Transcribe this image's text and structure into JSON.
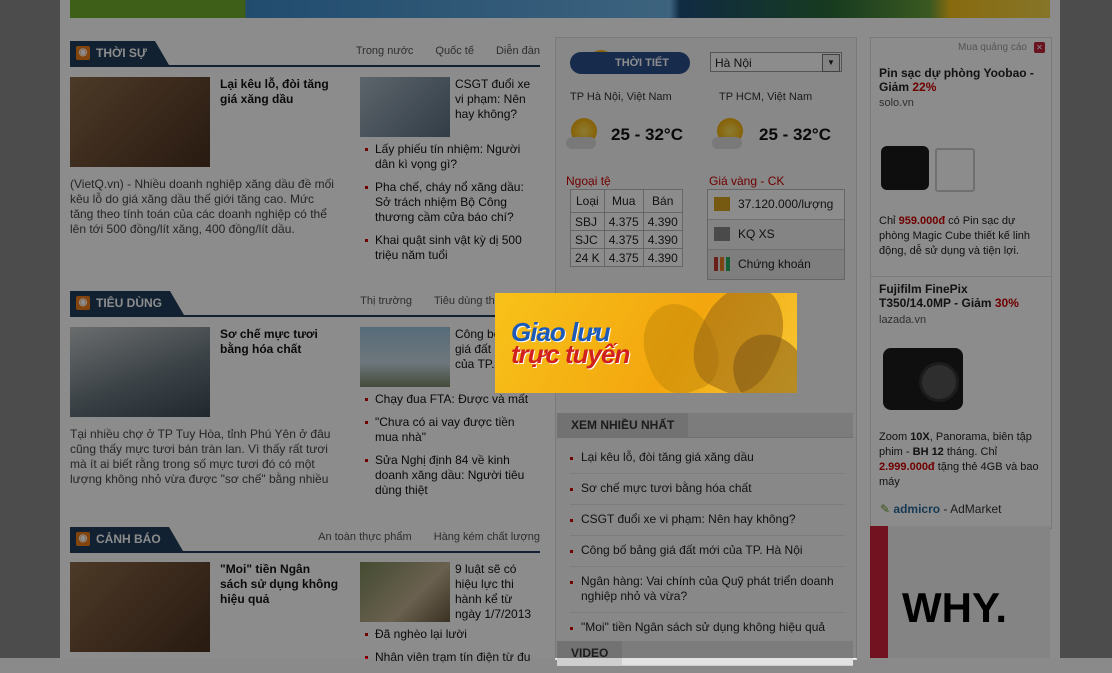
{
  "sections": {
    "thoi_su": {
      "title": "THỜI SỰ",
      "links": [
        "Trong nước",
        "Quốc tế",
        "Diễn đàn"
      ],
      "lead_title": "Lại kêu lỗ, đòi tăng giá xăng dầu",
      "lead_summary": "(VietQ.vn) - Nhiều doanh nghiệp xăng dầu đề mối kêu lỗ do giá xăng dầu thế giới tăng cao. Mức tăng theo tính toán của các doanh nghiệp có thể lên tới 500 đồng/lít xăng, 400 đồng/lít dầu.",
      "side_title": "CSGT đuổi xe vi phạm: Nên hay không?",
      "bullets": [
        "Lấy phiếu tín nhiệm: Người dân kì vọng gì?",
        "Pha chế, cháy nổ xăng dầu: Sở trách nhiệm Bộ Công thương cầm cửa báo chí?",
        "Khai quật sinh vật kỳ dị 500 triệu năm tuổi"
      ]
    },
    "tieu_dung": {
      "title": "TIÊU DÙNG",
      "links": [
        "Thị trường",
        "Tiêu dùng thông minh"
      ],
      "lead_title": "Sơ chế mực tươi bằng hóa chất",
      "lead_summary": "Tại nhiều chợ ở TP Tuy Hòa, tỉnh Phú Yên ở đâu cũng thấy mực tươi bán tràn lan. Vì thấy rất tươi mà ít ai biết rằng trong số mực tươi đó có một lượng không nhỏ vừa được \"sơ chế\" bằng nhiều",
      "side_title": "Công bố bảng giá đất mới của TP. Hà Nội",
      "bullets": [
        "Chạy đua FTA: Được và mất",
        "\"Chưa có ai vay được tiền mua nhà\"",
        "Sửa Nghị định 84 về kinh doanh xăng dầu: Người tiêu dùng thiệt"
      ]
    },
    "canh_bao": {
      "title": "CẢNH BÁO",
      "links": [
        "An toàn thực phẩm",
        "Hàng kém chất lượng"
      ],
      "lead_title": "\"Moi\" tiền Ngân sách sử dụng không hiệu quả",
      "side_title": "9 luật sẽ có hiệu lực thi hành kể từ ngày 1/7/2013",
      "bullets": [
        "Đã nghèo lại lười",
        "Nhân viên trạm tín điện từ đu"
      ]
    }
  },
  "weather": {
    "label": "THỜI TIẾT",
    "city_select": "Hà Nội",
    "city1": "TP Hà Nội, Việt Nam",
    "temp1": "25 - 32°C",
    "city2": "TP HCM, Việt Nam",
    "temp2": "25 - 32°C"
  },
  "forex": {
    "label": "Ngoại tệ",
    "headers": [
      "Loại",
      "Mua",
      "Bán"
    ],
    "rows": [
      [
        "SBJ",
        "4.375",
        "4.390"
      ],
      [
        "SJC",
        "4.375",
        "4.390"
      ],
      [
        "24 K",
        "4.375",
        "4.390"
      ]
    ]
  },
  "gold": {
    "label": "Giá vàng - CK",
    "items": [
      "37.120.000/lượng",
      "KQ XS",
      "Chứng khoán"
    ]
  },
  "promo": {
    "line1": "Giao lưu",
    "line2": "trực tuyến"
  },
  "most_read": {
    "title": "XEM NHIỀU NHẤT",
    "items": [
      "Lại kêu lỗ, đòi tăng giá xăng dầu",
      "Sơ chế mực tươi bằng hóa chất",
      "CSGT đuổi xe vi phạm: Nên hay không?",
      "Công bố bảng giá đất mới của TP. Hà Nội",
      "Ngân hàng: Vai chính của Quỹ phát triển doanh nghiệp nhỏ và vừa?",
      "\"Moi\" tiền Ngân sách sử dụng không hiệu quả"
    ],
    "next_tab": "VIDEO"
  },
  "ads": {
    "label": "Mua quảng cáo",
    "ad1": {
      "title": "Pin sạc dự phòng Yoobao - Giảm",
      "discount": "22%",
      "source": "solo.vn",
      "desc_pre": "Chỉ",
      "price": "959.000đ",
      "desc_post": "có Pin sạc dự phòng Magic Cube thiết kế linh động, dễ sử dụng và tiện lợi."
    },
    "ad2": {
      "title": "Fujifilm FinePix T350/14.0MP - Giảm",
      "discount": "30%",
      "source": "lazada.vn",
      "desc_a": "Zoom",
      "desc_b": "10X",
      "desc_c": ", Panorama, biên tập phim -",
      "desc_d": "BH 12",
      "desc_e": "tháng. Chỉ",
      "price": "2.999.000đ",
      "desc_post": "tặng thẻ 4GB và bao máy"
    },
    "network_a": "admicro",
    "network_b": " - AdMarket",
    "why": "WHY."
  }
}
